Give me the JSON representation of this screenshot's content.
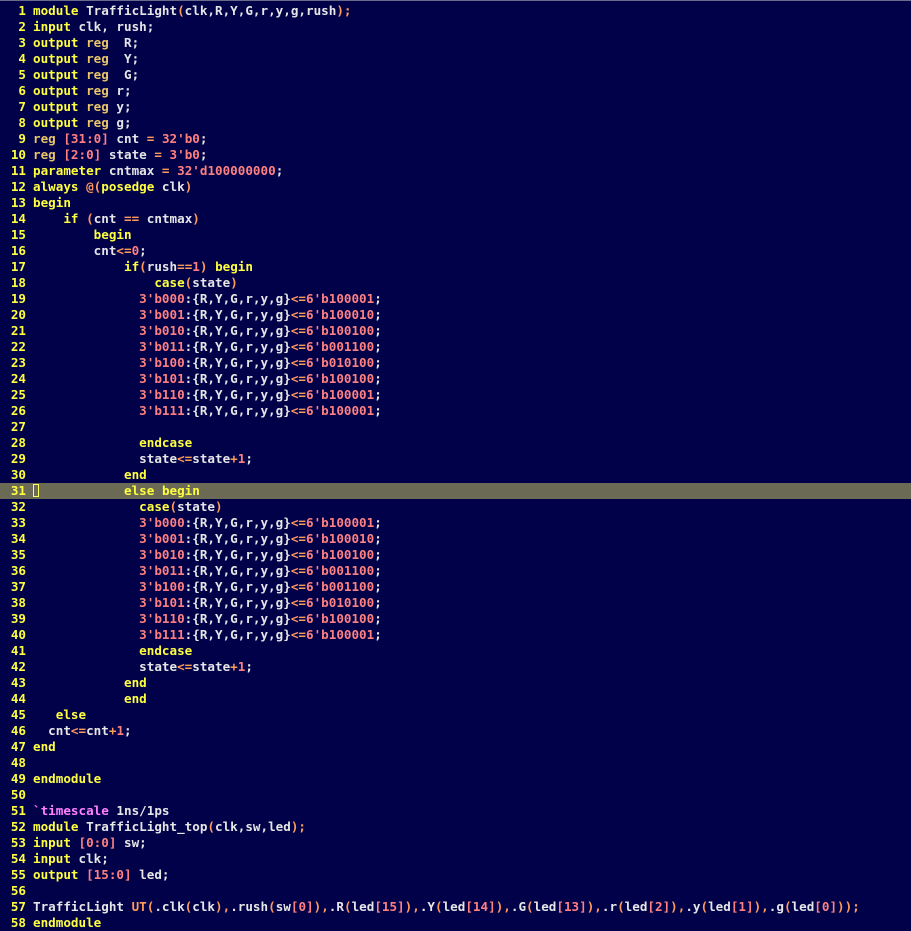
{
  "editor": {
    "current_line": 31,
    "colors": {
      "background": "#01014a",
      "line_numbers": "#ffff40",
      "keyword": "#ffff40",
      "type": "#e9c46a",
      "number": "#ff8080",
      "operator": "#ff9a5a",
      "identifier": "#e6e6e6",
      "directive": "#ff80ff",
      "cursor_line": "#6b6b55"
    },
    "lines": [
      [
        [
          "kw",
          "module"
        ],
        [
          "id",
          " TrafficLight"
        ],
        [
          "op",
          "("
        ],
        [
          "id",
          "clk,R,Y,G,r,y,g,rush"
        ],
        [
          "op",
          ");"
        ]
      ],
      [
        [
          "kw",
          "input"
        ],
        [
          "id",
          " clk, rush;"
        ]
      ],
      [
        [
          "kw",
          "output"
        ],
        [
          "id",
          " "
        ],
        [
          "tp",
          "reg"
        ],
        [
          "id",
          "  R;"
        ]
      ],
      [
        [
          "kw",
          "output"
        ],
        [
          "id",
          " "
        ],
        [
          "tp",
          "reg"
        ],
        [
          "id",
          "  Y;"
        ]
      ],
      [
        [
          "kw",
          "output"
        ],
        [
          "id",
          " "
        ],
        [
          "tp",
          "reg"
        ],
        [
          "id",
          "  G;"
        ]
      ],
      [
        [
          "kw",
          "output"
        ],
        [
          "id",
          " "
        ],
        [
          "tp",
          "reg"
        ],
        [
          "id",
          " r;"
        ]
      ],
      [
        [
          "kw",
          "output"
        ],
        [
          "id",
          " "
        ],
        [
          "tp",
          "reg"
        ],
        [
          "id",
          " y;"
        ]
      ],
      [
        [
          "kw",
          "output"
        ],
        [
          "id",
          " "
        ],
        [
          "tp",
          "reg"
        ],
        [
          "id",
          " g;"
        ]
      ],
      [
        [
          "tp",
          "reg"
        ],
        [
          "id",
          " "
        ],
        [
          "num",
          "[31:0]"
        ],
        [
          "id",
          " cnt "
        ],
        [
          "op",
          "="
        ],
        [
          "id",
          " "
        ],
        [
          "num",
          "32'b0"
        ],
        [
          "id",
          ";"
        ]
      ],
      [
        [
          "tp",
          "reg"
        ],
        [
          "id",
          " "
        ],
        [
          "num",
          "[2:0]"
        ],
        [
          "id",
          " state "
        ],
        [
          "op",
          "="
        ],
        [
          "id",
          " "
        ],
        [
          "num",
          "3'b0"
        ],
        [
          "id",
          ";"
        ]
      ],
      [
        [
          "kw",
          "parameter"
        ],
        [
          "id",
          " cntmax "
        ],
        [
          "op",
          "="
        ],
        [
          "id",
          " "
        ],
        [
          "num",
          "32'd100000000"
        ],
        [
          "id",
          ";"
        ]
      ],
      [
        [
          "kw",
          "always"
        ],
        [
          "id",
          " "
        ],
        [
          "op",
          "@("
        ],
        [
          "kw",
          "posedge"
        ],
        [
          "id",
          " clk"
        ],
        [
          "op",
          ")"
        ]
      ],
      [
        [
          "kw",
          "begin"
        ]
      ],
      [
        [
          "id",
          "    "
        ],
        [
          "kw",
          "if"
        ],
        [
          "id",
          " "
        ],
        [
          "op",
          "("
        ],
        [
          "id",
          "cnt "
        ],
        [
          "op",
          "=="
        ],
        [
          "id",
          " cntmax"
        ],
        [
          "op",
          ")"
        ]
      ],
      [
        [
          "id",
          "        "
        ],
        [
          "kw",
          "begin"
        ]
      ],
      [
        [
          "id",
          "        cnt"
        ],
        [
          "op",
          "<="
        ],
        [
          "num",
          "0"
        ],
        [
          "id",
          ";"
        ]
      ],
      [
        [
          "id",
          "            "
        ],
        [
          "kw",
          "if"
        ],
        [
          "op",
          "("
        ],
        [
          "id",
          "rush"
        ],
        [
          "op",
          "=="
        ],
        [
          "num",
          "1"
        ],
        [
          "op",
          ")"
        ],
        [
          "id",
          " "
        ],
        [
          "kw",
          "begin"
        ]
      ],
      [
        [
          "id",
          "                "
        ],
        [
          "kw",
          "case"
        ],
        [
          "op",
          "("
        ],
        [
          "id",
          "state"
        ],
        [
          "op",
          ")"
        ]
      ],
      [
        [
          "id",
          "              "
        ],
        [
          "num",
          "3'b000"
        ],
        [
          "id",
          ":{R,Y,G,r,y,g}"
        ],
        [
          "op",
          "<="
        ],
        [
          "num",
          "6'b100001"
        ],
        [
          "id",
          ";"
        ]
      ],
      [
        [
          "id",
          "              "
        ],
        [
          "num",
          "3'b001"
        ],
        [
          "id",
          ":{R,Y,G,r,y,g}"
        ],
        [
          "op",
          "<="
        ],
        [
          "num",
          "6'b100010"
        ],
        [
          "id",
          ";"
        ]
      ],
      [
        [
          "id",
          "              "
        ],
        [
          "num",
          "3'b010"
        ],
        [
          "id",
          ":{R,Y,G,r,y,g}"
        ],
        [
          "op",
          "<="
        ],
        [
          "num",
          "6'b100100"
        ],
        [
          "id",
          ";"
        ]
      ],
      [
        [
          "id",
          "              "
        ],
        [
          "num",
          "3'b011"
        ],
        [
          "id",
          ":{R,Y,G,r,y,g}"
        ],
        [
          "op",
          "<="
        ],
        [
          "num",
          "6'b001100"
        ],
        [
          "id",
          ";"
        ]
      ],
      [
        [
          "id",
          "              "
        ],
        [
          "num",
          "3'b100"
        ],
        [
          "id",
          ":{R,Y,G,r,y,g}"
        ],
        [
          "op",
          "<="
        ],
        [
          "num",
          "6'b010100"
        ],
        [
          "id",
          ";"
        ]
      ],
      [
        [
          "id",
          "              "
        ],
        [
          "num",
          "3'b101"
        ],
        [
          "id",
          ":{R,Y,G,r,y,g}"
        ],
        [
          "op",
          "<="
        ],
        [
          "num",
          "6'b100100"
        ],
        [
          "id",
          ";"
        ]
      ],
      [
        [
          "id",
          "              "
        ],
        [
          "num",
          "3'b110"
        ],
        [
          "id",
          ":{R,Y,G,r,y,g}"
        ],
        [
          "op",
          "<="
        ],
        [
          "num",
          "6'b100001"
        ],
        [
          "id",
          ";"
        ]
      ],
      [
        [
          "id",
          "              "
        ],
        [
          "num",
          "3'b111"
        ],
        [
          "id",
          ":{R,Y,G,r,y,g}"
        ],
        [
          "op",
          "<="
        ],
        [
          "num",
          "6'b100001"
        ],
        [
          "id",
          ";"
        ]
      ],
      [],
      [
        [
          "id",
          "              "
        ],
        [
          "kw",
          "endcase"
        ]
      ],
      [
        [
          "id",
          "              state"
        ],
        [
          "op",
          "<="
        ],
        [
          "id",
          "state"
        ],
        [
          "op",
          "+"
        ],
        [
          "num",
          "1"
        ],
        [
          "id",
          ";"
        ]
      ],
      [
        [
          "id",
          "            "
        ],
        [
          "kw",
          "end"
        ]
      ],
      [
        [
          "id",
          "            "
        ],
        [
          "kw",
          "else"
        ],
        [
          "id",
          " "
        ],
        [
          "kw",
          "begin"
        ]
      ],
      [
        [
          "id",
          "              "
        ],
        [
          "kw",
          "case"
        ],
        [
          "op",
          "("
        ],
        [
          "id",
          "state"
        ],
        [
          "op",
          ")"
        ]
      ],
      [
        [
          "id",
          "              "
        ],
        [
          "num",
          "3'b000"
        ],
        [
          "id",
          ":{R,Y,G,r,y,g}"
        ],
        [
          "op",
          "<="
        ],
        [
          "num",
          "6'b100001"
        ],
        [
          "id",
          ";"
        ]
      ],
      [
        [
          "id",
          "              "
        ],
        [
          "num",
          "3'b001"
        ],
        [
          "id",
          ":{R,Y,G,r,y,g}"
        ],
        [
          "op",
          "<="
        ],
        [
          "num",
          "6'b100010"
        ],
        [
          "id",
          ";"
        ]
      ],
      [
        [
          "id",
          "              "
        ],
        [
          "num",
          "3'b010"
        ],
        [
          "id",
          ":{R,Y,G,r,y,g}"
        ],
        [
          "op",
          "<="
        ],
        [
          "num",
          "6'b100100"
        ],
        [
          "id",
          ";"
        ]
      ],
      [
        [
          "id",
          "              "
        ],
        [
          "num",
          "3'b011"
        ],
        [
          "id",
          ":{R,Y,G,r,y,g}"
        ],
        [
          "op",
          "<="
        ],
        [
          "num",
          "6'b001100"
        ],
        [
          "id",
          ";"
        ]
      ],
      [
        [
          "id",
          "              "
        ],
        [
          "num",
          "3'b100"
        ],
        [
          "id",
          ":{R,Y,G,r,y,g}"
        ],
        [
          "op",
          "<="
        ],
        [
          "num",
          "6'b001100"
        ],
        [
          "id",
          ";"
        ]
      ],
      [
        [
          "id",
          "              "
        ],
        [
          "num",
          "3'b101"
        ],
        [
          "id",
          ":{R,Y,G,r,y,g}"
        ],
        [
          "op",
          "<="
        ],
        [
          "num",
          "6'b010100"
        ],
        [
          "id",
          ";"
        ]
      ],
      [
        [
          "id",
          "              "
        ],
        [
          "num",
          "3'b110"
        ],
        [
          "id",
          ":{R,Y,G,r,y,g}"
        ],
        [
          "op",
          "<="
        ],
        [
          "num",
          "6'b100100"
        ],
        [
          "id",
          ";"
        ]
      ],
      [
        [
          "id",
          "              "
        ],
        [
          "num",
          "3'b111"
        ],
        [
          "id",
          ":{R,Y,G,r,y,g}"
        ],
        [
          "op",
          "<="
        ],
        [
          "num",
          "6'b100001"
        ],
        [
          "id",
          ";"
        ]
      ],
      [
        [
          "id",
          "              "
        ],
        [
          "kw",
          "endcase"
        ]
      ],
      [
        [
          "id",
          "              state"
        ],
        [
          "op",
          "<="
        ],
        [
          "id",
          "state"
        ],
        [
          "op",
          "+"
        ],
        [
          "num",
          "1"
        ],
        [
          "id",
          ";"
        ]
      ],
      [
        [
          "id",
          "            "
        ],
        [
          "kw",
          "end"
        ]
      ],
      [
        [
          "id",
          "            "
        ],
        [
          "kw",
          "end"
        ]
      ],
      [
        [
          "id",
          "   "
        ],
        [
          "kw",
          "else"
        ]
      ],
      [
        [
          "id",
          "  cnt"
        ],
        [
          "op",
          "<="
        ],
        [
          "id",
          "cnt"
        ],
        [
          "op",
          "+"
        ],
        [
          "num",
          "1"
        ],
        [
          "id",
          ";"
        ]
      ],
      [
        [
          "kw",
          "end"
        ]
      ],
      [],
      [
        [
          "kw",
          "endmodule"
        ]
      ],
      [],
      [
        [
          "pp",
          "`timescale"
        ],
        [
          "id",
          " 1ns/1ps"
        ]
      ],
      [
        [
          "kw",
          "module"
        ],
        [
          "id",
          " TrafficLight_top"
        ],
        [
          "op",
          "("
        ],
        [
          "id",
          "clk,sw,led"
        ],
        [
          "op",
          ");"
        ]
      ],
      [
        [
          "kw",
          "input"
        ],
        [
          "id",
          " "
        ],
        [
          "num",
          "[0:0]"
        ],
        [
          "id",
          " sw;"
        ]
      ],
      [
        [
          "kw",
          "input"
        ],
        [
          "id",
          " clk;"
        ]
      ],
      [
        [
          "kw",
          "output"
        ],
        [
          "id",
          " "
        ],
        [
          "num",
          "[15:0]"
        ],
        [
          "id",
          " led;"
        ]
      ],
      [],
      [
        [
          "id",
          "TrafficLight "
        ],
        [
          "op",
          "UT("
        ],
        [
          "id",
          ".clk"
        ],
        [
          "op",
          "("
        ],
        [
          "id",
          "clk"
        ],
        [
          "op",
          "),"
        ],
        [
          "id",
          ".rush"
        ],
        [
          "op",
          "("
        ],
        [
          "id",
          "sw"
        ],
        [
          "num",
          "[0]"
        ],
        [
          "op",
          "),"
        ],
        [
          "id",
          ".R"
        ],
        [
          "op",
          "("
        ],
        [
          "id",
          "led"
        ],
        [
          "num",
          "[15]"
        ],
        [
          "op",
          "),"
        ],
        [
          "id",
          ".Y"
        ],
        [
          "op",
          "("
        ],
        [
          "id",
          "led"
        ],
        [
          "num",
          "[14]"
        ],
        [
          "op",
          "),"
        ],
        [
          "id",
          ".G"
        ],
        [
          "op",
          "("
        ],
        [
          "id",
          "led"
        ],
        [
          "num",
          "[13]"
        ],
        [
          "op",
          "),"
        ],
        [
          "id",
          ".r"
        ],
        [
          "op",
          "("
        ],
        [
          "id",
          "led"
        ],
        [
          "num",
          "[2]"
        ],
        [
          "op",
          "),"
        ],
        [
          "id",
          ".y"
        ],
        [
          "op",
          "("
        ],
        [
          "id",
          "led"
        ],
        [
          "num",
          "[1]"
        ],
        [
          "op",
          "),"
        ],
        [
          "id",
          ".g"
        ],
        [
          "op",
          "("
        ],
        [
          "id",
          "led"
        ],
        [
          "num",
          "[0]"
        ],
        [
          "op",
          "));"
        ]
      ],
      [
        [
          "kw",
          "endmodule"
        ]
      ]
    ]
  }
}
